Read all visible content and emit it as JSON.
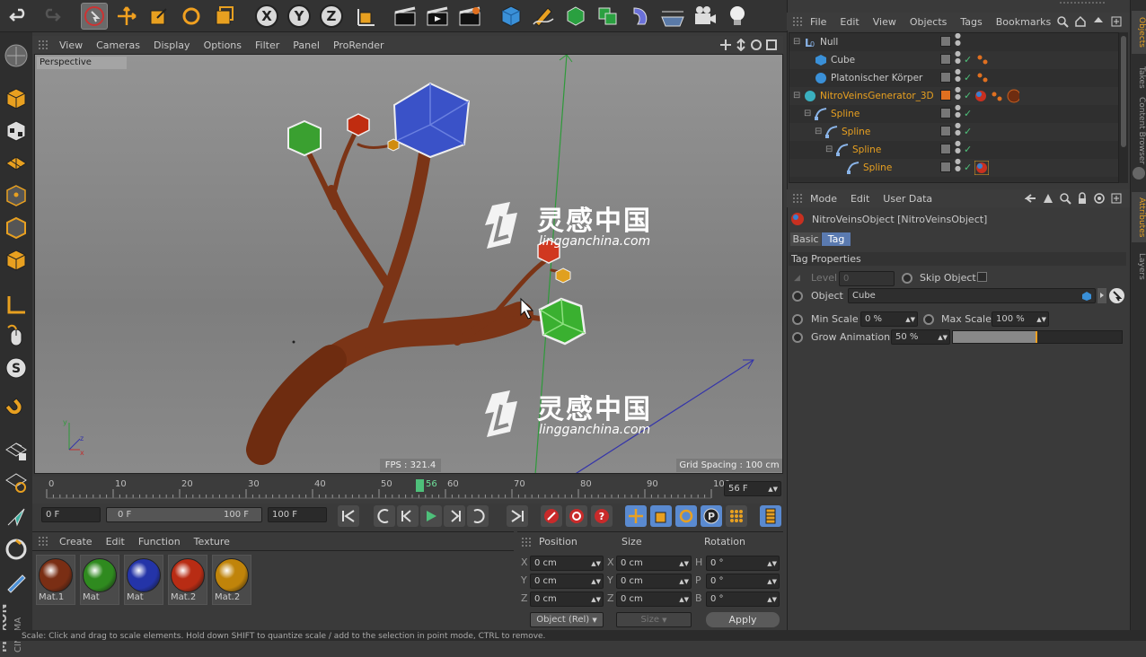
{
  "viewport": {
    "menu": [
      "View",
      "Cameras",
      "Display",
      "Options",
      "Filter",
      "Panel",
      "ProRender"
    ],
    "label": "Perspective",
    "fps": "FPS : 321.4",
    "grid_spacing": "Grid Spacing : 100 cm",
    "watermark_cn": "灵感中国",
    "watermark_url": "lingganchina.com"
  },
  "timeline": {
    "ticks": [
      "0",
      "10",
      "20",
      "30",
      "40",
      "50",
      "60",
      "70",
      "80",
      "90",
      "100"
    ],
    "current": "56",
    "current_field": "56 F"
  },
  "playbar": {
    "start": "0 F",
    "range_start": "0 F",
    "range_end": "100 F",
    "end": "100 F"
  },
  "materials": {
    "menu": [
      "Create",
      "Edit",
      "Function",
      "Texture"
    ],
    "items": [
      {
        "name": "Mat.1",
        "color": "#7a2e14"
      },
      {
        "name": "Mat",
        "color": "#2f8a1f"
      },
      {
        "name": "Mat",
        "color": "#2434a8"
      },
      {
        "name": "Mat.2",
        "color": "#b82c14"
      },
      {
        "name": "Mat.2",
        "color": "#c0840a"
      }
    ]
  },
  "coords": {
    "headers": [
      "Position",
      "Size",
      "Rotation"
    ],
    "rows": [
      {
        "a": "X",
        "pos": "0 cm",
        "b": "X",
        "size": "0 cm",
        "c": "H",
        "rot": "0 °"
      },
      {
        "a": "Y",
        "pos": "0 cm",
        "b": "Y",
        "size": "0 cm",
        "c": "P",
        "rot": "0 °"
      },
      {
        "a": "Z",
        "pos": "0 cm",
        "b": "Z",
        "size": "0 cm",
        "c": "B",
        "rot": "0 °"
      }
    ],
    "mode": "Object (Rel)",
    "size_mode": "Size",
    "apply": "Apply"
  },
  "objects": {
    "menu": [
      "File",
      "Edit",
      "View",
      "Objects",
      "Tags",
      "Bookmarks"
    ],
    "items": [
      {
        "name": "Null",
        "indent": 0,
        "orange": false
      },
      {
        "name": "Cube",
        "indent": 1,
        "orange": false
      },
      {
        "name": "Platonischer Körper",
        "indent": 1,
        "orange": false
      },
      {
        "name": "NitroVeinsGenerator_3D",
        "indent": 0,
        "orange": true
      },
      {
        "name": "Spline",
        "indent": 1,
        "orange": true
      },
      {
        "name": "Spline",
        "indent": 2,
        "orange": true
      },
      {
        "name": "Spline",
        "indent": 3,
        "orange": true
      },
      {
        "name": "Spline",
        "indent": 4,
        "orange": true
      }
    ]
  },
  "attributes": {
    "menu": [
      "Mode",
      "Edit",
      "User Data"
    ],
    "object_title": "NitroVeinsObject [NitroVeinsObject]",
    "tabs": [
      "Basic",
      "Tag"
    ],
    "section": "Tag Properties",
    "level_label": "Level",
    "level_value": "0",
    "skip_label": "Skip Object",
    "object_label": "Object",
    "object_value": "Cube",
    "min_scale_label": "Min Scale",
    "min_scale_value": "0 %",
    "max_scale_label": "Max Scale",
    "max_scale_value": "100 %",
    "grow_label": "Grow Animation",
    "grow_value": "50 %",
    "grow_fraction": 0.5
  },
  "side_tabs": [
    "Objects",
    "Takes",
    "Content Browser",
    "Attributes",
    "Layers"
  ],
  "status": "Scale: Click and drag to scale elements. Hold down SHIFT to quantize scale / add to the selection in point mode, CTRL to remove."
}
